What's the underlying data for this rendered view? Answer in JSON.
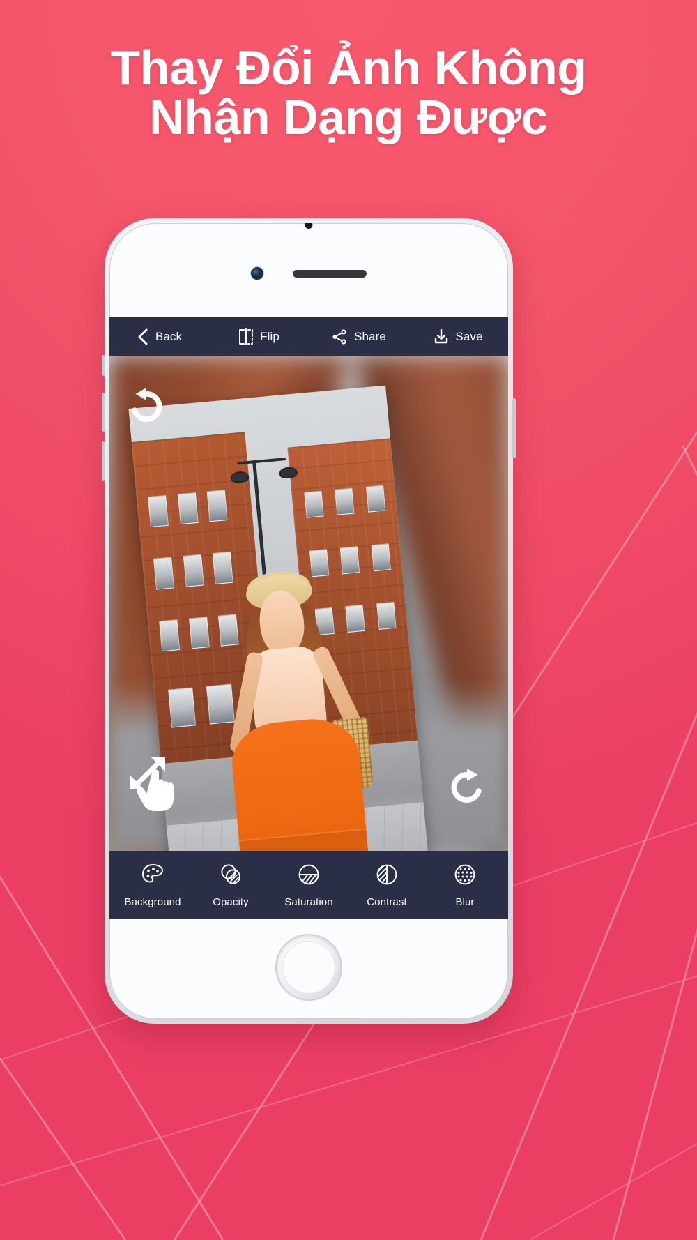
{
  "page": {
    "background_color": "#f4566a",
    "accent_color": "#2b2e47"
  },
  "heading": {
    "line1": "Thay Đổi Ảnh Không",
    "line2": "Nhận Dạng Được"
  },
  "app": {
    "topbar": [
      {
        "label": "Back",
        "icon": "chevron-left-icon"
      },
      {
        "label": "Flip",
        "icon": "flip-horizontal-icon"
      },
      {
        "label": "Share",
        "icon": "share-nodes-icon"
      },
      {
        "label": "Save",
        "icon": "download-save-icon"
      }
    ],
    "canvas_overlays": [
      {
        "icon": "rotate-left-icon",
        "name": "rotate-counter-clockwise-handle"
      },
      {
        "icon": "rotate-right-icon",
        "name": "rotate-clockwise-handle"
      },
      {
        "icon": "resize-hand-icon",
        "name": "resize-drag-handle"
      }
    ],
    "bottombar": [
      {
        "label": "Background",
        "icon": "palette-icon"
      },
      {
        "label": "Opacity",
        "icon": "opacity-circles-icon"
      },
      {
        "label": "Saturation",
        "icon": "saturation-half-icon"
      },
      {
        "label": "Contrast",
        "icon": "contrast-icon"
      },
      {
        "label": "Blur",
        "icon": "blur-dots-icon"
      }
    ]
  }
}
